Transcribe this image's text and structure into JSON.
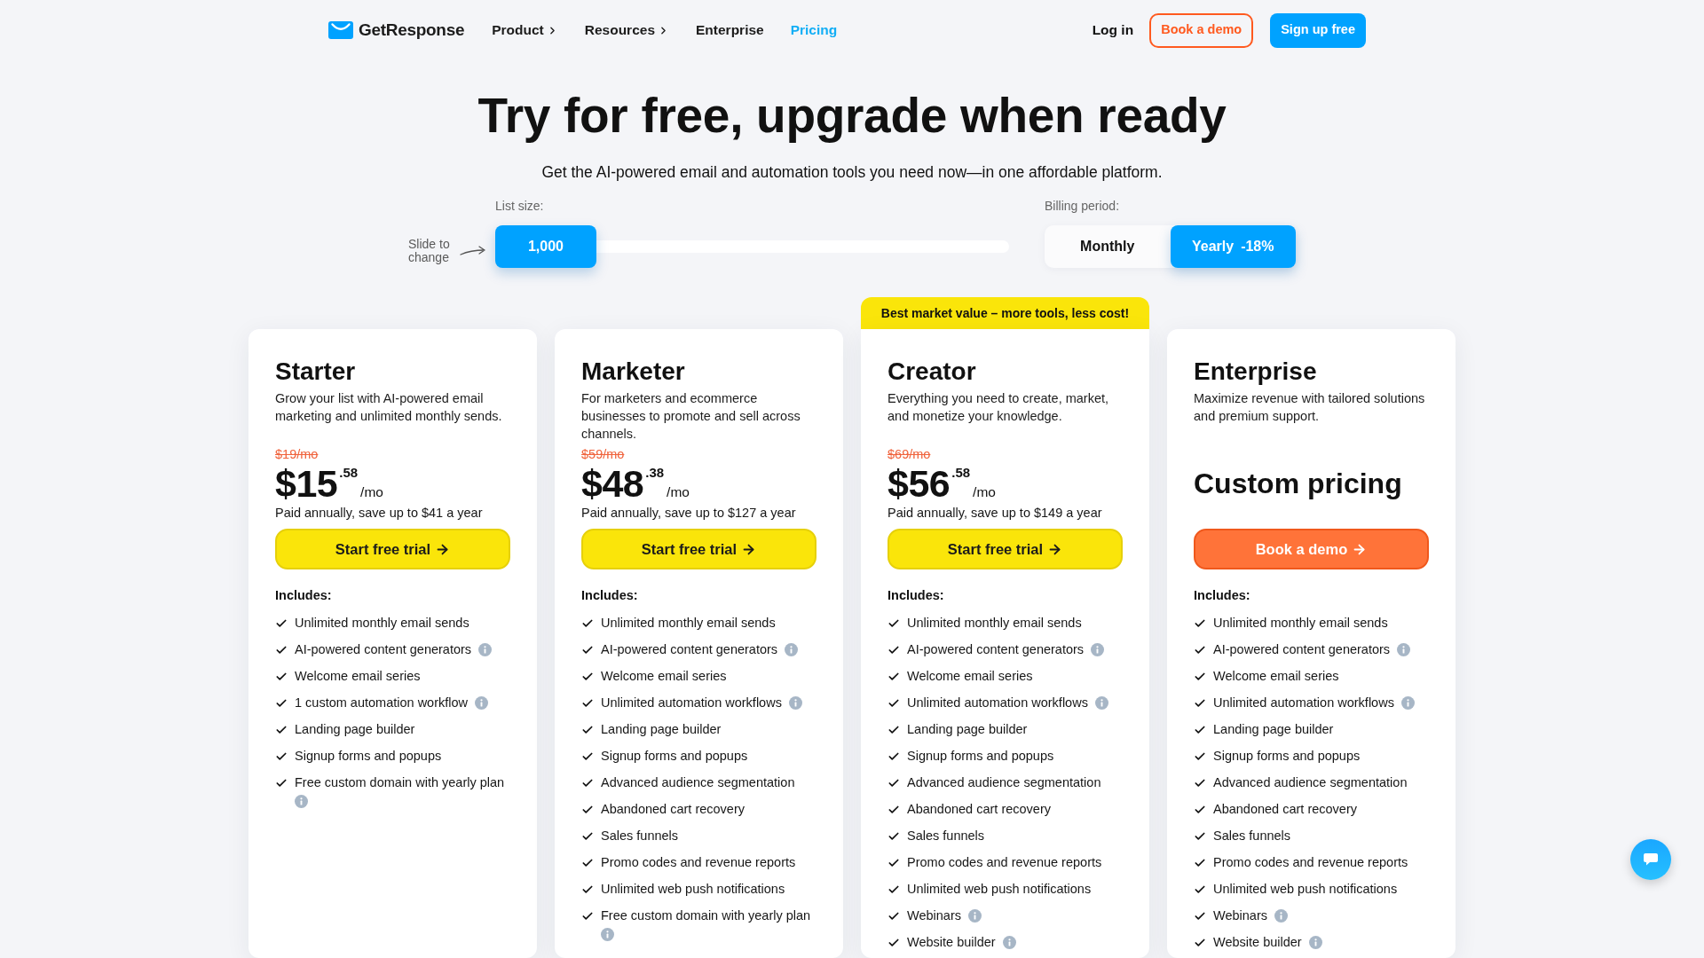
{
  "nav": {
    "brand": "GetResponse",
    "items": [
      {
        "label": "Product",
        "has_menu": true,
        "selected": false
      },
      {
        "label": "Resources",
        "has_menu": true,
        "selected": false
      },
      {
        "label": "Enterprise",
        "has_menu": false,
        "selected": false
      },
      {
        "label": "Pricing",
        "has_menu": false,
        "selected": true
      }
    ],
    "login": "Log in",
    "demo_button": "Book a demo",
    "signup_button": "Sign up free"
  },
  "hero": {
    "title": "Try for free, upgrade when ready",
    "subtitle": "Get the AI-powered email and automation tools you need now—in one affordable platform."
  },
  "list_size": {
    "label": "List size:",
    "hint": "Slide to change",
    "value": "1,000",
    "level": 0
  },
  "billing": {
    "label": "Billing period:",
    "options": [
      {
        "label": "Monthly",
        "selected": false
      },
      {
        "label": "Yearly",
        "discount": "-18%",
        "selected": true
      }
    ]
  },
  "plans": [
    {
      "kind": "priced",
      "name": "Starter",
      "description": "Grow your list with AI-powered email marketing and unlimited monthly sends.",
      "old_price": "$19/mo",
      "price": "$15",
      "cents": ".58",
      "period": "/mo",
      "note": "Paid annually, save up to $41 a year",
      "cta": {
        "label": "Start free trial",
        "kind": "trial"
      },
      "includes_label": "Includes:",
      "features": [
        {
          "text": "Unlimited monthly email sends",
          "info": false
        },
        {
          "text": "AI-powered content generators",
          "info": true
        },
        {
          "text": "Welcome email series",
          "info": false
        },
        {
          "text": "1 custom automation workflow",
          "info": true
        },
        {
          "text": "Landing page builder",
          "info": false
        },
        {
          "text": "Signup forms and popups",
          "info": false
        },
        {
          "text": "Free custom domain with yearly plan",
          "info": true
        }
      ]
    },
    {
      "kind": "priced",
      "name": "Marketer",
      "description": "For marketers and ecommerce businesses to promote and sell across channels.",
      "old_price": "$59/mo",
      "price": "$48",
      "cents": ".38",
      "period": "/mo",
      "note": "Paid annually, save up to $127 a year",
      "cta": {
        "label": "Start free trial",
        "kind": "trial"
      },
      "includes_label": "Includes:",
      "features": [
        {
          "text": "Unlimited monthly email sends",
          "info": false
        },
        {
          "text": "AI-powered content generators",
          "info": true
        },
        {
          "text": "Welcome email series",
          "info": false
        },
        {
          "text": "Unlimited automation workflows",
          "info": true
        },
        {
          "text": "Landing page builder",
          "info": false
        },
        {
          "text": "Signup forms and popups",
          "info": false
        },
        {
          "text": "Advanced audience segmentation",
          "info": false
        },
        {
          "text": "Abandoned cart recovery",
          "info": false
        },
        {
          "text": "Sales funnels",
          "info": false
        },
        {
          "text": "Promo codes and revenue reports",
          "info": false
        },
        {
          "text": "Unlimited web push notifications",
          "info": false
        },
        {
          "text": "Free custom domain with yearly plan",
          "info": true
        }
      ]
    },
    {
      "kind": "priced",
      "badge": "Best market value – more tools, less cost!",
      "name": "Creator",
      "description": "Everything you need to create, market, and monetize your knowledge.",
      "old_price": "$69/mo",
      "price": "$56",
      "cents": ".58",
      "period": "/mo",
      "note": "Paid annually, save up to $149 a year",
      "cta": {
        "label": "Start free trial",
        "kind": "trial"
      },
      "includes_label": "Includes:",
      "features": [
        {
          "text": "Unlimited monthly email sends",
          "info": false
        },
        {
          "text": "AI-powered content generators",
          "info": true
        },
        {
          "text": "Welcome email series",
          "info": false
        },
        {
          "text": "Unlimited automation workflows",
          "info": true
        },
        {
          "text": "Landing page builder",
          "info": false
        },
        {
          "text": "Signup forms and popups",
          "info": false
        },
        {
          "text": "Advanced audience segmentation",
          "info": false
        },
        {
          "text": "Abandoned cart recovery",
          "info": false
        },
        {
          "text": "Sales funnels",
          "info": false
        },
        {
          "text": "Promo codes and revenue reports",
          "info": false
        },
        {
          "text": "Unlimited web push notifications",
          "info": false
        },
        {
          "text": "Webinars",
          "info": true
        },
        {
          "text": "Website builder",
          "info": true
        }
      ]
    },
    {
      "kind": "custom",
      "name": "Enterprise",
      "description": "Maximize revenue with tailored solutions and premium support.",
      "price_text": "Custom pricing",
      "cta": {
        "label": "Book a demo",
        "kind": "demo"
      },
      "includes_label": "Includes:",
      "features": [
        {
          "text": "Unlimited monthly email sends",
          "info": false
        },
        {
          "text": "AI-powered content generators",
          "info": true
        },
        {
          "text": "Welcome email series",
          "info": false
        },
        {
          "text": "Unlimited automation workflows",
          "info": true
        },
        {
          "text": "Landing page builder",
          "info": false
        },
        {
          "text": "Signup forms and popups",
          "info": false
        },
        {
          "text": "Advanced audience segmentation",
          "info": false
        },
        {
          "text": "Abandoned cart recovery",
          "info": false
        },
        {
          "text": "Sales funnels",
          "info": false
        },
        {
          "text": "Promo codes and revenue reports",
          "info": false
        },
        {
          "text": "Unlimited web push notifications",
          "info": false
        },
        {
          "text": "Webinars",
          "info": true
        },
        {
          "text": "Website builder",
          "info": true
        }
      ]
    }
  ]
}
